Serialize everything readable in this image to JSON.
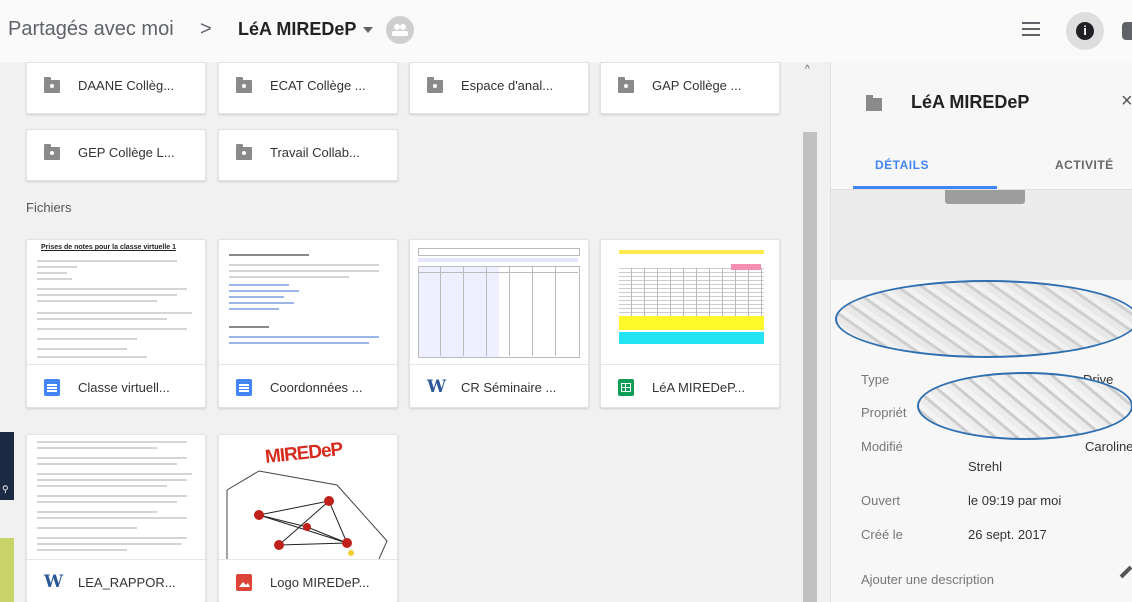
{
  "header": {
    "breadcrumb_root": "Partagés avec moi",
    "breadcrumb_separator": ">",
    "current_folder": "LéA MIREDeP",
    "icons": [
      "chevron-down-icon",
      "shared-people-icon",
      "list-view-icon",
      "info-icon",
      "settings-icon"
    ]
  },
  "folders": [
    {
      "name": "DAANE Collèg..."
    },
    {
      "name": "ECAT Collège ..."
    },
    {
      "name": "Espace d'anal..."
    },
    {
      "name": "GAP Collège ..."
    },
    {
      "name": "GEP Collège L..."
    },
    {
      "name": "Travail Collab..."
    }
  ],
  "files_section_label": "Fichiers",
  "files": [
    {
      "name": "Classe virtuell...",
      "type": "doc",
      "thumb_title": "Prises de notes pour la classe virtuelle 1"
    },
    {
      "name": "Coordonnées ...",
      "type": "doc"
    },
    {
      "name": "CR Séminaire ...",
      "type": "word",
      "type_glyph": "W"
    },
    {
      "name": "LéA MIREDeP...",
      "type": "sheet"
    },
    {
      "name": "LEA_RAPPOR...",
      "type": "word",
      "type_glyph": "W"
    },
    {
      "name": "Logo MIREDeP...",
      "type": "image",
      "thumb_title": "MIREDeP"
    }
  ],
  "details": {
    "title": "LéA MIREDeP",
    "close_glyph": "×",
    "tab_details": "DÉTAILS",
    "tab_activity": "ACTIVITÉ",
    "info_glyph": "i",
    "scroll_up_glyph": "^",
    "properties": {
      "type_label": "Type",
      "type_value_partial": "Drive",
      "owner_label": "Propriét",
      "modified_label": "Modifié",
      "modified_value_partial": "Caroline",
      "modified_value_line2": "Strehl",
      "opened_label": "Ouvert",
      "opened_value": "le 09:19 par moi",
      "created_label": "Créé le",
      "created_value": "26 sept. 2017"
    },
    "add_description": "Ajouter une description"
  },
  "colors": {
    "accent_blue": "#4285f4",
    "doc_blue": "#4285f4",
    "sheet_green": "#0f9d58",
    "image_red": "#db4437",
    "word_blue": "#2b5797",
    "logo_red": "#d62b1f"
  }
}
